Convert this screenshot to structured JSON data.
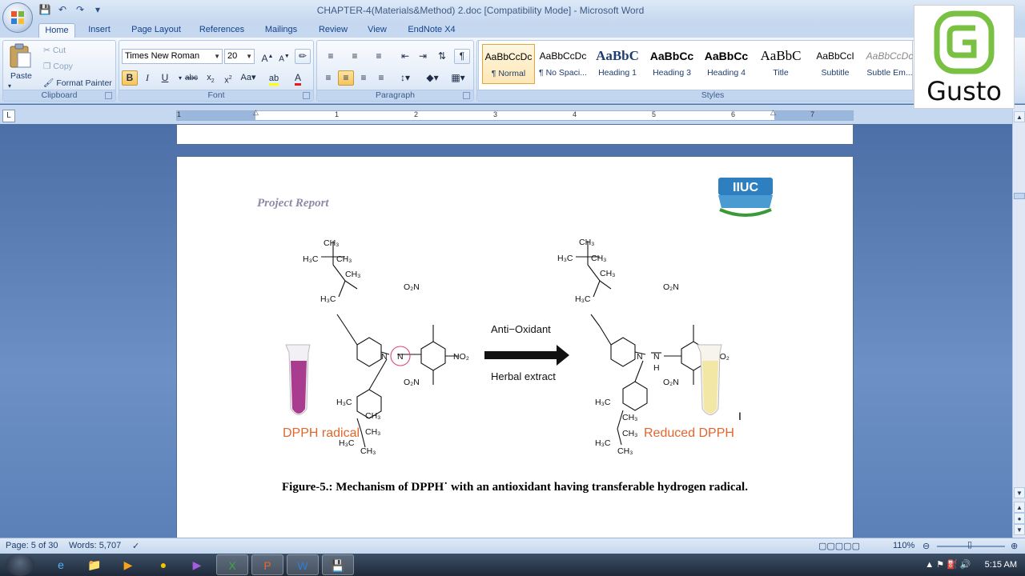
{
  "window": {
    "title": "CHAPTER-4(Materials&Method) 2.doc [Compatibility Mode] - Microsoft Word"
  },
  "tabs": [
    "Home",
    "Insert",
    "Page Layout",
    "References",
    "Mailings",
    "Review",
    "View",
    "EndNote X4"
  ],
  "active_tab": "Home",
  "clipboard": {
    "paste": "Paste",
    "cut": "Cut",
    "copy": "Copy",
    "format_painter": "Format Painter",
    "label": "Clipboard"
  },
  "font": {
    "name": "Times New Roman",
    "size": "20",
    "label": "Font"
  },
  "paragraph": {
    "label": "Paragraph"
  },
  "styles": {
    "label": "Styles",
    "items": [
      {
        "sample": "AaBbCcDc",
        "name": "¶ Normal"
      },
      {
        "sample": "AaBbCcDc",
        "name": "¶ No Spaci..."
      },
      {
        "sample": "AaBbC",
        "name": "Heading 1"
      },
      {
        "sample": "AaBbCc",
        "name": "Heading 3"
      },
      {
        "sample": "AaBbCc",
        "name": "Heading 4"
      },
      {
        "sample": "AaBbC",
        "name": "Title"
      },
      {
        "sample": "AaBbCcI",
        "name": "Subtitle"
      },
      {
        "sample": "AaBbCcDc",
        "name": "Subtle Em..."
      }
    ]
  },
  "ruler_numbers": [
    "1",
    "1",
    "2",
    "3",
    "4",
    "5",
    "6",
    "7"
  ],
  "document": {
    "header_text": "Project Report",
    "logo_text": "IIUC",
    "figure": {
      "left_label": "DPPH radical",
      "right_label": "Reduced DPPH",
      "arrow_top": "Anti−Oxidant",
      "arrow_bottom": "Herbal extract",
      "chem": {
        "ch3": "CH₃",
        "h3c": "H₃C",
        "o2n": "O₂N",
        "no2": "NO₂",
        "n": "N",
        "h": "H"
      }
    },
    "caption": "Figure-5.: Mechanism of DPPH˙ with an antioxidant having transferable hydrogen radical."
  },
  "status": {
    "page": "Page: 5 of 30",
    "words": "Words: 5,707",
    "zoom": "110%"
  },
  "taskbar": {
    "time": "5:15 AM"
  },
  "watermark": {
    "text": "Gusto"
  }
}
